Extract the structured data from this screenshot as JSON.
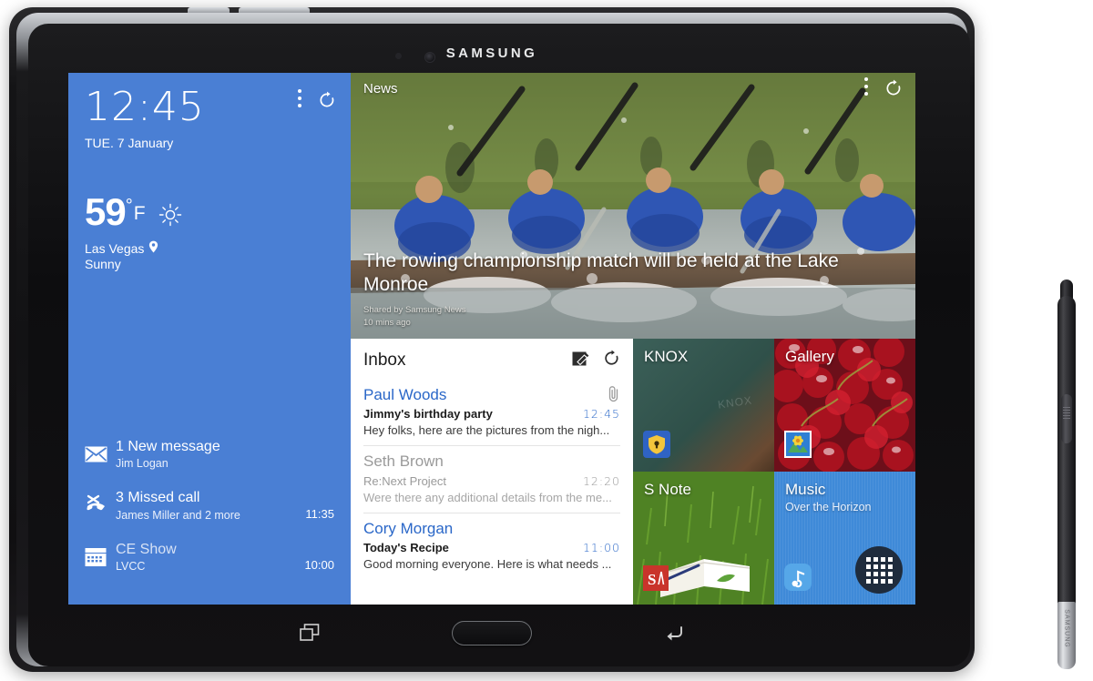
{
  "device": {
    "brand": "SAMSUNG",
    "nav": {
      "recents_label": "Recent apps",
      "home_label": "Home",
      "back_label": "Back"
    },
    "stylus_label": "SAMSUNG"
  },
  "clock_widget": {
    "time": "12:45",
    "date": "TUE. 7 January",
    "menu_icon": "more-vertical-icon",
    "refresh_icon": "refresh-icon"
  },
  "weather_widget": {
    "temperature": "59",
    "degree_symbol": "°",
    "unit": "F",
    "city": "Las Vegas",
    "condition": "Sunny",
    "condition_icon": "sun-icon",
    "location_icon": "location-pin-icon"
  },
  "notifications": [
    {
      "icon": "envelope-icon",
      "title": "1 New message",
      "subtitle": "Jim Logan",
      "time": ""
    },
    {
      "icon": "missed-call-icon",
      "title": "3 Missed call",
      "subtitle": "James Miller and 2 more",
      "time": "11:35"
    },
    {
      "icon": "calendar-icon",
      "title": "CE Show",
      "subtitle": "LVCC",
      "time": "10:00"
    }
  ],
  "news_widget": {
    "title": "News",
    "headline": "The rowing championship match will be held at the Lake Monroe",
    "source": "Shared by Samsung News",
    "timestamp": "10 mins ago",
    "menu_icon": "more-vertical-icon",
    "refresh_icon": "refresh-icon"
  },
  "inbox_widget": {
    "title": "Inbox",
    "compose_icon": "compose-icon",
    "refresh_icon": "refresh-icon",
    "messages": [
      {
        "from": "Paul Woods",
        "subject": "Jimmy's birthday party",
        "preview": "Hey folks, here are the pictures from the nigh...",
        "time": "12:45",
        "unread": true,
        "attachment_icon": "paperclip-icon"
      },
      {
        "from": "Seth Brown",
        "subject": "Re:Next Project",
        "preview": "Were there any additional details from the me...",
        "time": "12:20",
        "unread": false,
        "attachment_icon": ""
      },
      {
        "from": "Cory Morgan",
        "subject": "Today's Recipe",
        "preview": "Good morning everyone. Here is what needs ...",
        "time": "11:00",
        "unread": true,
        "attachment_icon": ""
      }
    ]
  },
  "tiles": [
    {
      "label": "KNOX",
      "sublabel": "",
      "icon": "knox-shield-icon",
      "watermark": "KNOX"
    },
    {
      "label": "Gallery",
      "sublabel": "",
      "icon": "gallery-flower-icon",
      "watermark": ""
    },
    {
      "label": "S Note",
      "sublabel": "",
      "icon": "s-note-icon",
      "watermark": ""
    },
    {
      "label": "Music",
      "sublabel": "Over the Horizon",
      "icon": "music-note-icon",
      "watermark": ""
    }
  ],
  "apps_button": {
    "icon": "apps-grid-icon",
    "label": "Apps"
  },
  "colors": {
    "widget_blue": "#4a7fd4",
    "link_blue": "#2a67c8",
    "knox_teal": "#3c6059",
    "music_blue": "#3f8ad8"
  }
}
